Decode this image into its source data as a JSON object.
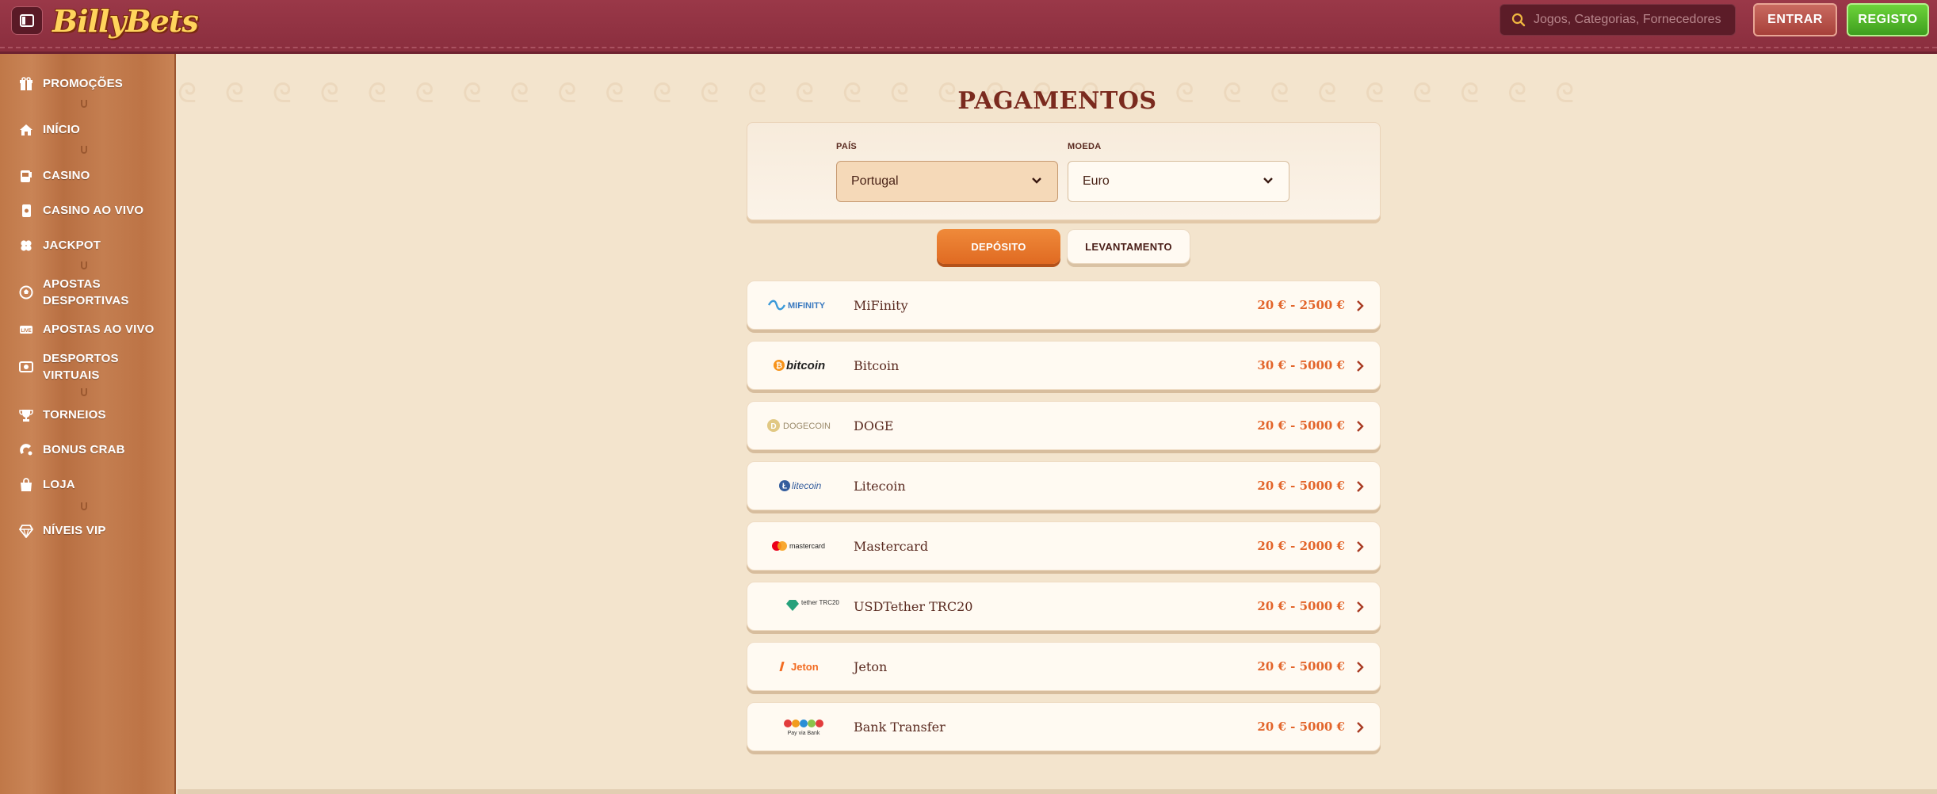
{
  "header": {
    "logo": "BillyBets",
    "search_placeholder": "Jogos, Categorias, Fornecedores",
    "login_label": "ENTRAR",
    "register_label": "REGISTO"
  },
  "sidebar": {
    "items": [
      {
        "label": "PROMOÇÕES",
        "icon": "gift-icon"
      },
      {
        "label": "INÍCIO",
        "icon": "home-icon"
      },
      {
        "label": "CASINO",
        "icon": "slot-icon"
      },
      {
        "label": "CASINO AO VIVO",
        "icon": "cards-icon"
      },
      {
        "label": "JACKPOT",
        "icon": "clover-icon"
      },
      {
        "label": "APOSTAS DESPORTIVAS",
        "icon": "soccer-ball-icon"
      },
      {
        "label": "APOSTAS AO VIVO",
        "icon": "live-icon"
      },
      {
        "label": "DESPORTOS VIRTUAIS",
        "icon": "virtual-sports-icon"
      },
      {
        "label": "TORNEIOS",
        "icon": "trophy-icon"
      },
      {
        "label": "BONUS CRAB",
        "icon": "crab-icon"
      },
      {
        "label": "LOJA",
        "icon": "shop-bag-icon"
      },
      {
        "label": "NÍVEIS VIP",
        "icon": "diamond-icon"
      }
    ]
  },
  "main": {
    "title": "PAGAMENTOS",
    "country_label": "PAÍS",
    "country_value": "Portugal",
    "currency_label": "MOEDA",
    "currency_value": "Euro",
    "tabs": [
      {
        "label": "DEPÓSITO",
        "active": true
      },
      {
        "label": "LEVANTAMENTO",
        "active": false
      }
    ],
    "methods": [
      {
        "logo": "MIFINITY",
        "name": "MiFinity",
        "range": "20 € - 2500 €"
      },
      {
        "logo": "bitcoin",
        "name": "Bitcoin",
        "range": "30 € - 5000 €"
      },
      {
        "logo": "DOGECOIN",
        "name": "DOGE",
        "range": "20 € - 5000 €"
      },
      {
        "logo": "litecoin",
        "name": "Litecoin",
        "range": "20 € - 5000 €"
      },
      {
        "logo": "mastercard",
        "name": "Mastercard",
        "range": "20 € - 2000 €"
      },
      {
        "logo": "tether TRC20",
        "name": "USDTether TRC20",
        "range": "20 € - 5000 €"
      },
      {
        "logo": "Jeton",
        "name": "Jeton",
        "range": "20 € - 5000 €"
      },
      {
        "logo": "Pay via Bank",
        "name": "Bank Transfer",
        "range": "20 € - 5000 €"
      }
    ]
  },
  "colors": {
    "header_bg": "#8f3242",
    "accent_orange": "#e2642a",
    "register_green": "#4cb826",
    "page_bg": "#f3e4cd"
  }
}
